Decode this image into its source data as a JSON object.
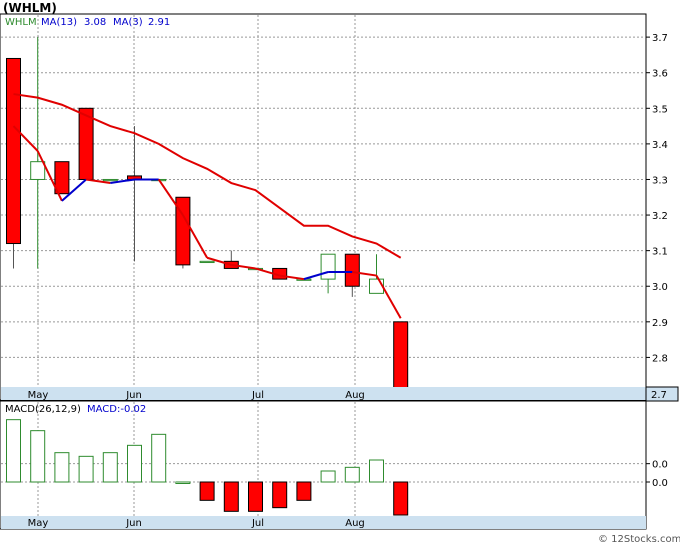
{
  "title": "(WHLM)",
  "legend": {
    "symbol": "WHLM",
    "ma13_label": "MA(13)",
    "ma13_value": "3.08",
    "ma3_label": "MA(3)",
    "ma3_value": "2.91"
  },
  "macd_legend": {
    "label": "MACD(26,12,9)",
    "value_label": "MACD:-0.02"
  },
  "last_price_label": "2.7",
  "footer": "© 12Stocks.com",
  "colors": {
    "up": "#2e8b2e",
    "down": "#ff0000",
    "ma_long": "#e00000",
    "ma_short_up": "#0000cc",
    "axis_band": "#cde1f0",
    "grid": "#999999"
  },
  "chart_data": {
    "type": "candlestick",
    "x_labels": [
      "May",
      "Jun",
      "Jul",
      "Aug"
    ],
    "y_ticks": [
      "3.7",
      "3.6",
      "3.5",
      "3.4",
      "3.3",
      "3.2",
      "3.1",
      "3.0",
      "2.9",
      "2.8",
      "2.7"
    ],
    "ylim": [
      2.7,
      3.72
    ],
    "candles": [
      {
        "open": 3.64,
        "close": 3.12,
        "high": 3.64,
        "low": 3.05
      },
      {
        "open": 3.3,
        "close": 3.35,
        "high": 3.7,
        "low": 3.05
      },
      {
        "open": 3.35,
        "close": 3.26,
        "high": 3.35,
        "low": 3.26
      },
      {
        "open": 3.5,
        "close": 3.3,
        "high": 3.5,
        "low": 3.3
      },
      {
        "open": 3.3,
        "close": 3.3,
        "high": 3.3,
        "low": 3.3
      },
      {
        "open": 3.31,
        "close": 3.3,
        "high": 3.45,
        "low": 3.07
      },
      {
        "open": 3.3,
        "close": 3.3,
        "high": 3.3,
        "low": 3.3
      },
      {
        "open": 3.25,
        "close": 3.06,
        "high": 3.25,
        "low": 3.05
      },
      {
        "open": 3.07,
        "close": 3.07,
        "high": 3.07,
        "low": 3.07
      },
      {
        "open": 3.07,
        "close": 3.05,
        "high": 3.1,
        "low": 3.05
      },
      {
        "open": 3.05,
        "close": 3.05,
        "high": 3.05,
        "low": 3.05
      },
      {
        "open": 3.05,
        "close": 3.02,
        "high": 3.05,
        "low": 3.02
      },
      {
        "open": 3.02,
        "close": 3.02,
        "high": 3.02,
        "low": 3.02
      },
      {
        "open": 3.02,
        "close": 3.09,
        "high": 3.09,
        "low": 2.98
      },
      {
        "open": 3.09,
        "close": 3.0,
        "high": 3.09,
        "low": 2.97
      },
      {
        "open": 2.98,
        "close": 3.02,
        "high": 3.09,
        "low": 2.98
      },
      {
        "open": 2.9,
        "close": 2.7,
        "high": 2.9,
        "low": 2.7
      }
    ],
    "ma13": [
      3.54,
      3.53,
      3.51,
      3.48,
      3.45,
      3.43,
      3.4,
      3.36,
      3.33,
      3.29,
      3.27,
      3.22,
      3.17,
      3.17,
      3.14,
      3.12,
      3.08
    ],
    "ma3": [
      3.45,
      3.38,
      3.24,
      3.3,
      3.29,
      3.3,
      3.3,
      3.2,
      3.08,
      3.06,
      3.05,
      3.03,
      3.02,
      3.04,
      3.04,
      3.03,
      2.91
    ],
    "macd": {
      "label": "MACD(26,12,9)",
      "ylim": [
        -0.09,
        0.18
      ],
      "y_ticks": [
        "0.0",
        "0.0"
      ],
      "histogram": [
        0.17,
        0.14,
        0.08,
        0.07,
        0.08,
        0.1,
        0.13,
        0.0,
        -0.05,
        -0.08,
        -0.08,
        -0.07,
        -0.05,
        0.03,
        0.04,
        0.06,
        -0.09
      ]
    }
  }
}
